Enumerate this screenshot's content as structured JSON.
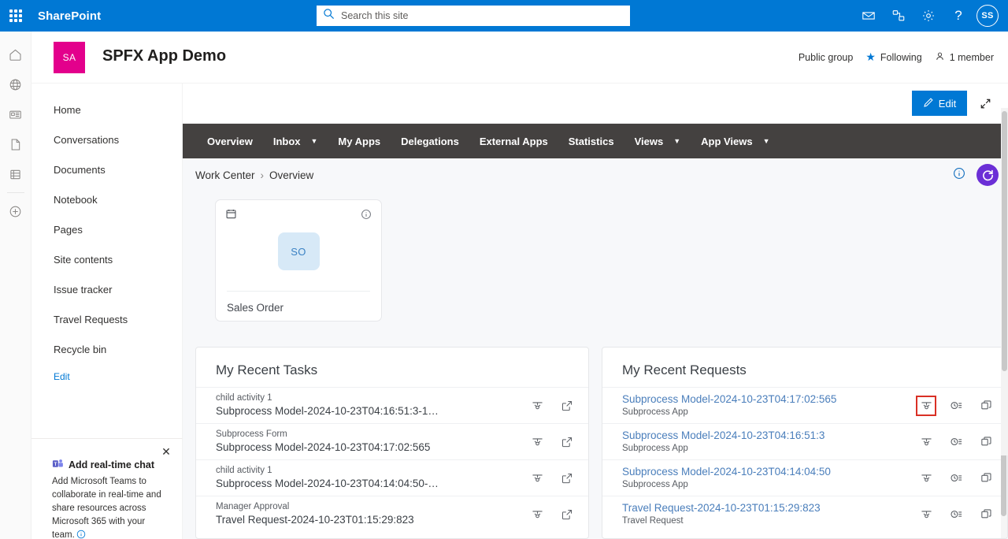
{
  "suitebar": {
    "waffle_label": "App launcher",
    "brand": "SharePoint",
    "search": {
      "placeholder": "Search this site",
      "value": ""
    },
    "icons": [
      {
        "name": "mail-icon",
        "label": "Mail"
      },
      {
        "name": "teams-chat-icon",
        "label": "Chat"
      },
      {
        "name": "gear-icon",
        "label": "Settings"
      },
      {
        "name": "help-icon",
        "label": "?"
      }
    ],
    "avatar_initials": "SS",
    "accent_color": "#0078d4"
  },
  "rail": {
    "items": [
      {
        "name": "home-icon",
        "label": "Home"
      },
      {
        "name": "globe-icon",
        "label": "Sites"
      },
      {
        "name": "news-icon",
        "label": "News"
      },
      {
        "name": "page-icon",
        "label": "Pages"
      },
      {
        "name": "lists-icon",
        "label": "Lists"
      },
      {
        "name": "create-icon",
        "label": "Create"
      }
    ]
  },
  "site": {
    "logo_initials": "SA",
    "logo_color": "#e3008c",
    "title": "SPFX App Demo",
    "privacy": "Public group",
    "following": "Following",
    "members": "1 member"
  },
  "leftnav": {
    "items": [
      {
        "label": "Home"
      },
      {
        "label": "Conversations"
      },
      {
        "label": "Documents"
      },
      {
        "label": "Notebook"
      },
      {
        "label": "Pages"
      },
      {
        "label": "Site contents"
      },
      {
        "label": "Issue tracker"
      },
      {
        "label": "Travel Requests"
      },
      {
        "label": "Recycle bin"
      }
    ],
    "edit_label": "Edit"
  },
  "promo": {
    "title": "Add real-time chat",
    "body": "Add Microsoft Teams to collaborate in real-time and share resources across Microsoft 365 with your team.",
    "close_label": "✕"
  },
  "commandbar": {
    "edit_label": "Edit",
    "expand_label": "Full screen"
  },
  "appnav": {
    "items": [
      {
        "label": "Overview",
        "caret": false
      },
      {
        "label": "Inbox",
        "caret": true
      },
      {
        "label": "My Apps",
        "caret": false
      },
      {
        "label": "Delegations",
        "caret": false
      },
      {
        "label": "External Apps",
        "caret": false
      },
      {
        "label": "Statistics",
        "caret": false
      },
      {
        "label": "Views",
        "caret": true
      },
      {
        "label": "App Views",
        "caret": true
      }
    ],
    "bg_color": "#444140"
  },
  "breadcrumb": {
    "root": "Work Center",
    "separator": "›",
    "current": "Overview",
    "refresh_color": "#6b2fd6"
  },
  "app_card": {
    "badge": "SO",
    "name": "Sales Order",
    "tile_color": "#d7e9f7"
  },
  "tasks": {
    "title": "My Recent Tasks",
    "rows": [
      {
        "name": "child activity 1",
        "detail": "Subprocess Model-2024-10-23T04:16:51:3-1…"
      },
      {
        "name": "Subprocess Form",
        "detail": "Subprocess Model-2024-10-23T04:17:02:565"
      },
      {
        "name": "child activity 1",
        "detail": "Subprocess Model-2024-10-23T04:14:04:50-…"
      },
      {
        "name": "Manager Approval",
        "detail": "Travel Request-2024-10-23T01:15:29:823"
      }
    ]
  },
  "requests": {
    "title": "My Recent Requests",
    "rows": [
      {
        "link": "Subprocess Model-2024-10-23T04:17:02:565",
        "app": "Subprocess App",
        "highlighted": true
      },
      {
        "link": "Subprocess Model-2024-10-23T04:16:51:3",
        "app": "Subprocess App",
        "highlighted": false
      },
      {
        "link": "Subprocess Model-2024-10-23T04:14:04:50",
        "app": "Subprocess App",
        "highlighted": false
      },
      {
        "link": "Travel Request-2024-10-23T01:15:29:823",
        "app": "Travel Request",
        "highlighted": false
      }
    ],
    "link_color": "#4a7ebb",
    "highlight_color": "#d93025"
  }
}
